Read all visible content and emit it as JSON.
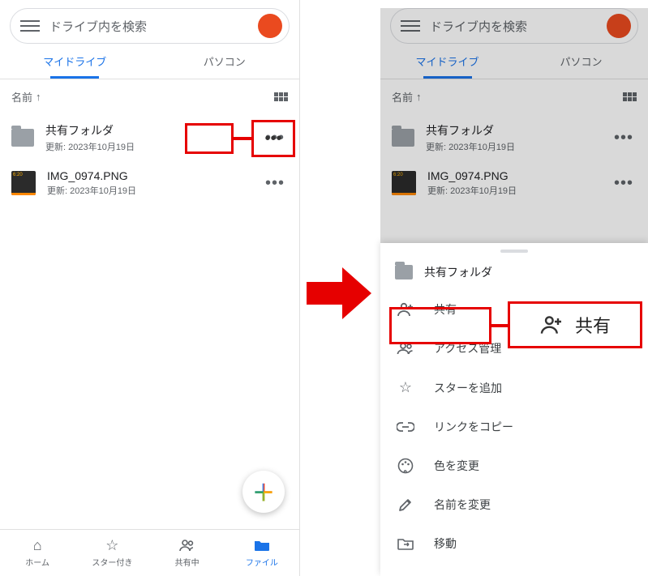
{
  "left": {
    "search_placeholder": "ドライブ内を検索",
    "tabs": {
      "my_drive": "マイドライブ",
      "computers": "パソコン"
    },
    "sort_label": "名前",
    "files": [
      {
        "name": "共有フォルダ",
        "sub": "更新: 2023年10月19日"
      },
      {
        "name": "IMG_0974.PNG",
        "sub": "更新: 2023年10月19日"
      }
    ],
    "nav": {
      "home": "ホーム",
      "starred": "スター付き",
      "shared": "共有中",
      "files": "ファイル"
    }
  },
  "right": {
    "search_placeholder": "ドライブ内を検索",
    "tabs": {
      "my_drive": "マイドライブ",
      "computers": "パソコン"
    },
    "sort_label": "名前",
    "files": [
      {
        "name": "共有フォルダ",
        "sub": "更新: 2023年10月19日"
      },
      {
        "name": "IMG_0974.PNG",
        "sub": "更新: 2023年10月19日"
      }
    ],
    "sheet": {
      "title": "共有フォルダ",
      "share": "共有",
      "access": "アクセス管理",
      "star": "スターを追加",
      "copylink": "リンクをコピー",
      "color": "色を変更",
      "rename": "名前を変更",
      "move": "移動"
    }
  },
  "callout": {
    "more": "•••",
    "share_label": "共有"
  }
}
